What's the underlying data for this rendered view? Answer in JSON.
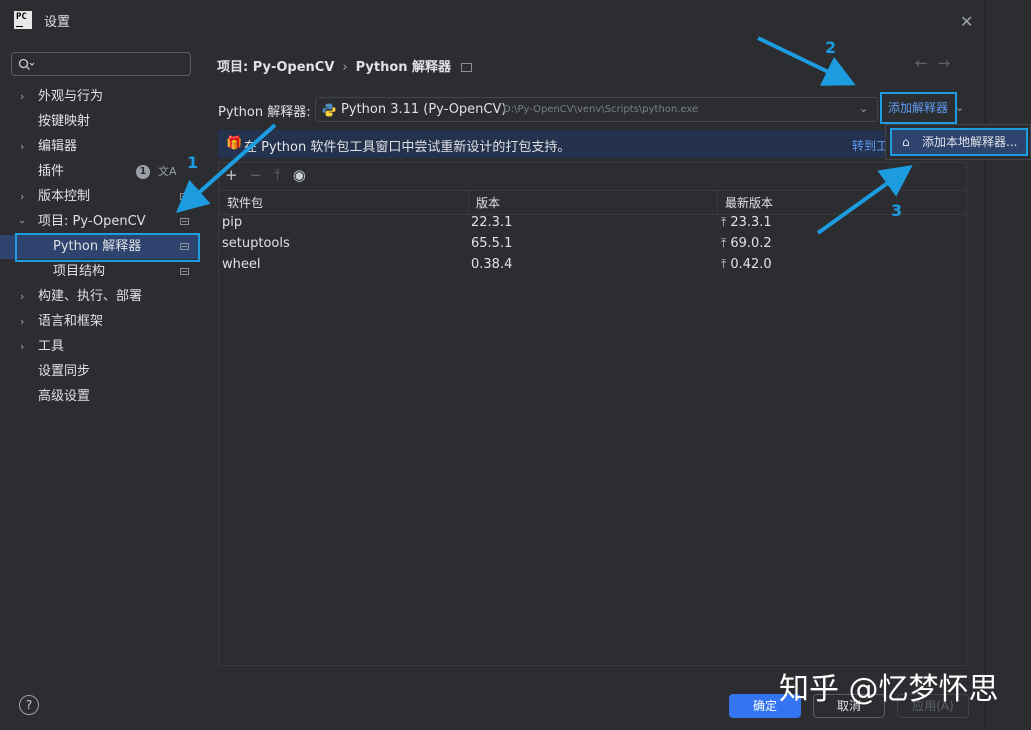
{
  "window": {
    "title": "设置",
    "app_logo": "PC"
  },
  "search": {
    "placeholder": ""
  },
  "sidebar": {
    "items": [
      {
        "label": "外观与行为",
        "expandable": true
      },
      {
        "label": "按键映射"
      },
      {
        "label": "编辑器",
        "expandable": true
      },
      {
        "label": "插件",
        "badge": "1"
      },
      {
        "label": "版本控制",
        "expandable": true
      },
      {
        "label": "项目: Py-OpenCV",
        "expanded": true
      },
      {
        "label": "Python 解释器",
        "selected": true
      },
      {
        "label": "项目结构"
      },
      {
        "label": "构建、执行、部署",
        "expandable": true
      },
      {
        "label": "语言和框架",
        "expandable": true
      },
      {
        "label": "工具",
        "expandable": true
      },
      {
        "label": "设置同步"
      },
      {
        "label": "高级设置"
      }
    ]
  },
  "breadcrumb": {
    "parent": "项目: Py-OpenCV",
    "current": "Python 解释器"
  },
  "interpreter": {
    "label": "Python 解释器:",
    "name": "Python 3.11 (Py-OpenCV)",
    "path": "D:\\Py-OpenCV\\venv\\Scripts\\python.exe",
    "add_label": "添加解释器"
  },
  "banner": {
    "text": "在 Python 软件包工具窗口中尝试重新设计的打包支持。",
    "link": "转到工"
  },
  "popup": {
    "item": "添加本地解释器..."
  },
  "table": {
    "headers": [
      "软件包",
      "版本",
      "最新版本"
    ],
    "rows": [
      {
        "package": "pip",
        "version": "22.3.1",
        "latest": "23.3.1"
      },
      {
        "package": "setuptools",
        "version": "65.5.1",
        "latest": "69.0.2"
      },
      {
        "package": "wheel",
        "version": "0.38.4",
        "latest": "0.42.0"
      }
    ]
  },
  "buttons": {
    "ok": "确定",
    "cancel": "取消",
    "apply": "应用(A)",
    "help": "?"
  },
  "annotations": [
    "1",
    "2",
    "3"
  ],
  "watermark": "知乎 @忆梦怀思",
  "colors": {
    "accent": "#3574f0",
    "annotation": "#1d9de0",
    "selection": "#2e436e",
    "background": "#2b2d30"
  }
}
